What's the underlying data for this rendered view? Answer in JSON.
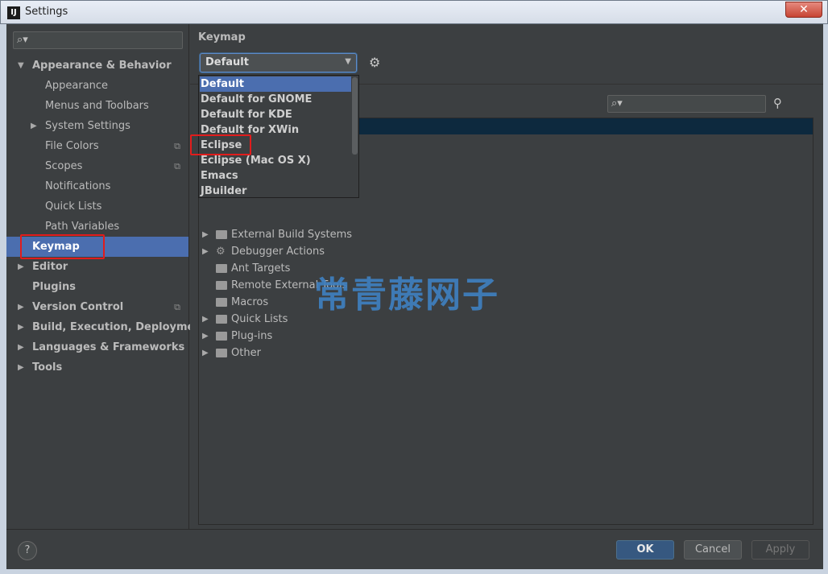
{
  "window": {
    "title": "Settings",
    "close_glyph": "✕",
    "app_icon_text": "IJ"
  },
  "sidebar": {
    "search_icon": "search-icon",
    "items": [
      {
        "label": "Appearance & Behavior",
        "level": 0,
        "expanded": true,
        "bold": true
      },
      {
        "label": "Appearance",
        "level": 1
      },
      {
        "label": "Menus and Toolbars",
        "level": 1
      },
      {
        "label": "System Settings",
        "level": 1,
        "collapsed": true
      },
      {
        "label": "File Colors",
        "level": 1,
        "copy_icon": true
      },
      {
        "label": "Scopes",
        "level": 1,
        "copy_icon": true
      },
      {
        "label": "Notifications",
        "level": 1
      },
      {
        "label": "Quick Lists",
        "level": 1
      },
      {
        "label": "Path Variables",
        "level": 1
      },
      {
        "label": "Keymap",
        "level": 0,
        "bold": true,
        "selected": true
      },
      {
        "label": "Editor",
        "level": 0,
        "bold": true,
        "collapsed": true
      },
      {
        "label": "Plugins",
        "level": 0,
        "bold": true
      },
      {
        "label": "Version Control",
        "level": 0,
        "bold": true,
        "collapsed": true,
        "copy_icon": true
      },
      {
        "label": "Build, Execution, Deployment",
        "level": 0,
        "bold": true,
        "collapsed": true
      },
      {
        "label": "Languages & Frameworks",
        "level": 0,
        "bold": true,
        "collapsed": true
      },
      {
        "label": "Tools",
        "level": 0,
        "bold": true,
        "collapsed": true
      }
    ]
  },
  "panel": {
    "title": "Keymap",
    "keymap_combo": {
      "value": "Default"
    },
    "dropdown_options": [
      {
        "label": "Default",
        "selected": true
      },
      {
        "label": "Default for GNOME"
      },
      {
        "label": "Default for KDE"
      },
      {
        "label": "Default for XWin"
      },
      {
        "label": "Eclipse",
        "highlighted": true
      },
      {
        "label": "Eclipse (Mac OS X)"
      },
      {
        "label": "Emacs"
      },
      {
        "label": "JBuilder"
      }
    ],
    "actions": [
      {
        "label": "External Build Systems",
        "expandable": true,
        "icon": "folder-gear-icon"
      },
      {
        "label": "Debugger Actions",
        "expandable": true,
        "icon": "gear-icon"
      },
      {
        "label": "Ant Targets",
        "expandable": false,
        "icon": "folder-icon"
      },
      {
        "label": "Remote External Tools",
        "expandable": false,
        "icon": "folder-icon"
      },
      {
        "label": "Macros",
        "expandable": false,
        "icon": "folder-icon"
      },
      {
        "label": "Quick Lists",
        "expandable": true,
        "icon": "folder-icon"
      },
      {
        "label": "Plug-ins",
        "expandable": true,
        "icon": "folder-icon"
      },
      {
        "label": "Other",
        "expandable": true,
        "icon": "folder-icon"
      }
    ]
  },
  "watermark": "常青藤网子",
  "buttons": {
    "help": "?",
    "ok": "OK",
    "cancel": "Cancel",
    "apply": "Apply"
  },
  "colors": {
    "background": "#3c3f41",
    "selection": "#4b6eaf",
    "highlight_box": "#e11c1c",
    "watermark": "#3f7fbf"
  }
}
